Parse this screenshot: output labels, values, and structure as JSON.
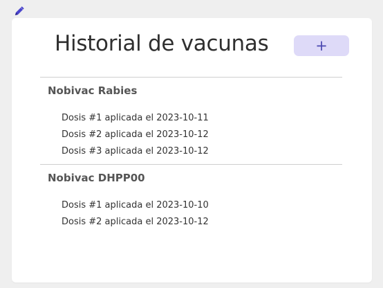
{
  "header": {
    "edit_icon": "pencil-icon"
  },
  "card": {
    "title": "Historial de vacunas",
    "add_button_label": "+"
  },
  "colors": {
    "page_background": "#efefef",
    "card_background": "#ffffff",
    "add_button_background": "#dedaf8",
    "add_button_text": "#4b48b0",
    "pencil_icon": "#4a44cc"
  },
  "vaccines": [
    {
      "name": "Nobivac Rabies",
      "doses": [
        "Dosis #1 aplicada el 2023-10-11",
        "Dosis #2 aplicada el 2023-10-12",
        "Dosis #3 aplicada el 2023-10-12"
      ]
    },
    {
      "name": "Nobivac DHPP00",
      "doses": [
        "Dosis #1 aplicada el 2023-10-10",
        "Dosis #2 aplicada el 2023-10-12"
      ]
    }
  ]
}
